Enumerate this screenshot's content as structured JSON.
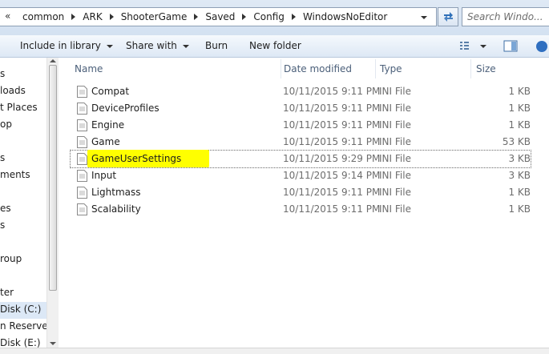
{
  "address": {
    "overflow_glyph": "«",
    "crumbs": [
      "common",
      "ARK",
      "ShooterGame",
      "Saved",
      "Config",
      "WindowsNoEditor"
    ]
  },
  "search": {
    "placeholder": "Search Windo..."
  },
  "toolbar": {
    "include_in_library": "Include in library",
    "share_with": "Share with",
    "burn": "Burn",
    "new_folder": "New folder"
  },
  "nav": {
    "items": [
      {
        "label": "s"
      },
      {
        "label": "loads"
      },
      {
        "label": "t Places"
      },
      {
        "label": "op"
      },
      {
        "label": "s"
      },
      {
        "label": "ments"
      },
      {
        "label": "es"
      },
      {
        "label": "s"
      },
      {
        "label": "roup"
      },
      {
        "label": "ter"
      },
      {
        "label": "Disk (C:)"
      },
      {
        "label": "n Reserved"
      },
      {
        "label": "Disk (E:)"
      }
    ]
  },
  "columns": {
    "name": "Name",
    "date": "Date modified",
    "type": "Type",
    "size": "Size"
  },
  "files": [
    {
      "name": "Compat",
      "date": "10/11/2015 9:11 PM",
      "type": "INI File",
      "size": "1 KB"
    },
    {
      "name": "DeviceProfiles",
      "date": "10/11/2015 9:11 PM",
      "type": "INI File",
      "size": "1 KB"
    },
    {
      "name": "Engine",
      "date": "10/11/2015 9:11 PM",
      "type": "INI File",
      "size": "1 KB"
    },
    {
      "name": "Game",
      "date": "10/11/2015 9:11 PM",
      "type": "INI File",
      "size": "53 KB"
    },
    {
      "name": "GameUserSettings",
      "date": "10/11/2015 9:29 PM",
      "type": "INI File",
      "size": "3 KB"
    },
    {
      "name": "Input",
      "date": "10/11/2015 9:14 PM",
      "type": "INI File",
      "size": "3 KB"
    },
    {
      "name": "Lightmass",
      "date": "10/11/2015 9:11 PM",
      "type": "INI File",
      "size": "1 KB"
    },
    {
      "name": "Scalability",
      "date": "10/11/2015 9:11 PM",
      "type": "INI File",
      "size": "1 KB"
    }
  ],
  "colors": {
    "highlight": "#ffff00",
    "nav_selected": "#dce8f6",
    "header_text": "#4c607a"
  }
}
